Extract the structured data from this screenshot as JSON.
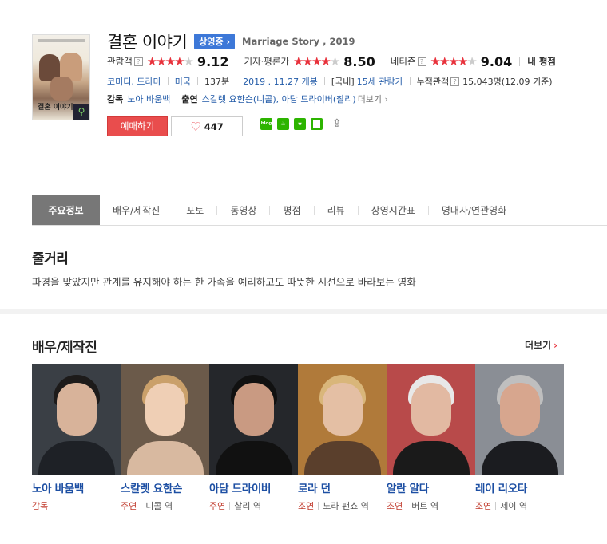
{
  "movie": {
    "title": "결혼 이야기",
    "status_badge": "상영중",
    "original_title": "Marriage Story , 2019",
    "poster_title": "결혼 이야기"
  },
  "ratings": [
    {
      "label": "관람객",
      "score": "9.12",
      "stars_filled": 4.5
    },
    {
      "label": "기자·평론가",
      "score": "8.50",
      "stars_filled": 4
    },
    {
      "label": "네티즌",
      "score": "9.04",
      "stars_filled": 4.5
    },
    {
      "label": "내 평점"
    }
  ],
  "info": {
    "genre": "코미디, 드라마",
    "country": "미국",
    "runtime": "137분",
    "release": "2019 . 11.27 개봉",
    "rating_prefix": "[국내]",
    "rating": "15세 관람가",
    "audience_label": "누적관객",
    "audience_value": "15,043명(12.09 기준)"
  },
  "credits": {
    "director_label": "감독",
    "director": "노아 바움백",
    "cast_label": "출연",
    "cast_text": "스칼렛 요한슨(니콜), 아담 드라이버(찰리)",
    "more": "더보기"
  },
  "actions": {
    "book": "예매하기",
    "like_count": "447"
  },
  "tabs": [
    "주요정보",
    "배우/제작진",
    "포토",
    "동영상",
    "평점",
    "리뷰",
    "상영시간표",
    "명대사/연관영화"
  ],
  "synopsis": {
    "title": "줄거리",
    "text": "파경을 맞았지만 관계를 유지해야 하는 한 가족을 예리하고도 따뜻한 시선으로 바라보는 영화"
  },
  "cast_section": {
    "title": "배우/제작진",
    "more": "더보기",
    "people": [
      {
        "name": "노아 바움백",
        "type": "감독",
        "role": ""
      },
      {
        "name": "스칼렛 요한슨",
        "type": "주연",
        "role": "니콜 역"
      },
      {
        "name": "아담 드라이버",
        "type": "주연",
        "role": "찰리 역"
      },
      {
        "name": "로라 던",
        "type": "조연",
        "role": "노라 팬쇼 역"
      },
      {
        "name": "알란 알다",
        "type": "조연",
        "role": "버트 역"
      },
      {
        "name": "레이 리오타",
        "type": "조연",
        "role": "제이 역"
      }
    ]
  },
  "colors": {
    "accent_red": "#e94d4d",
    "link_blue": "#225ba8",
    "star_red": "#e8323c",
    "badge_blue": "#3d78d8"
  }
}
